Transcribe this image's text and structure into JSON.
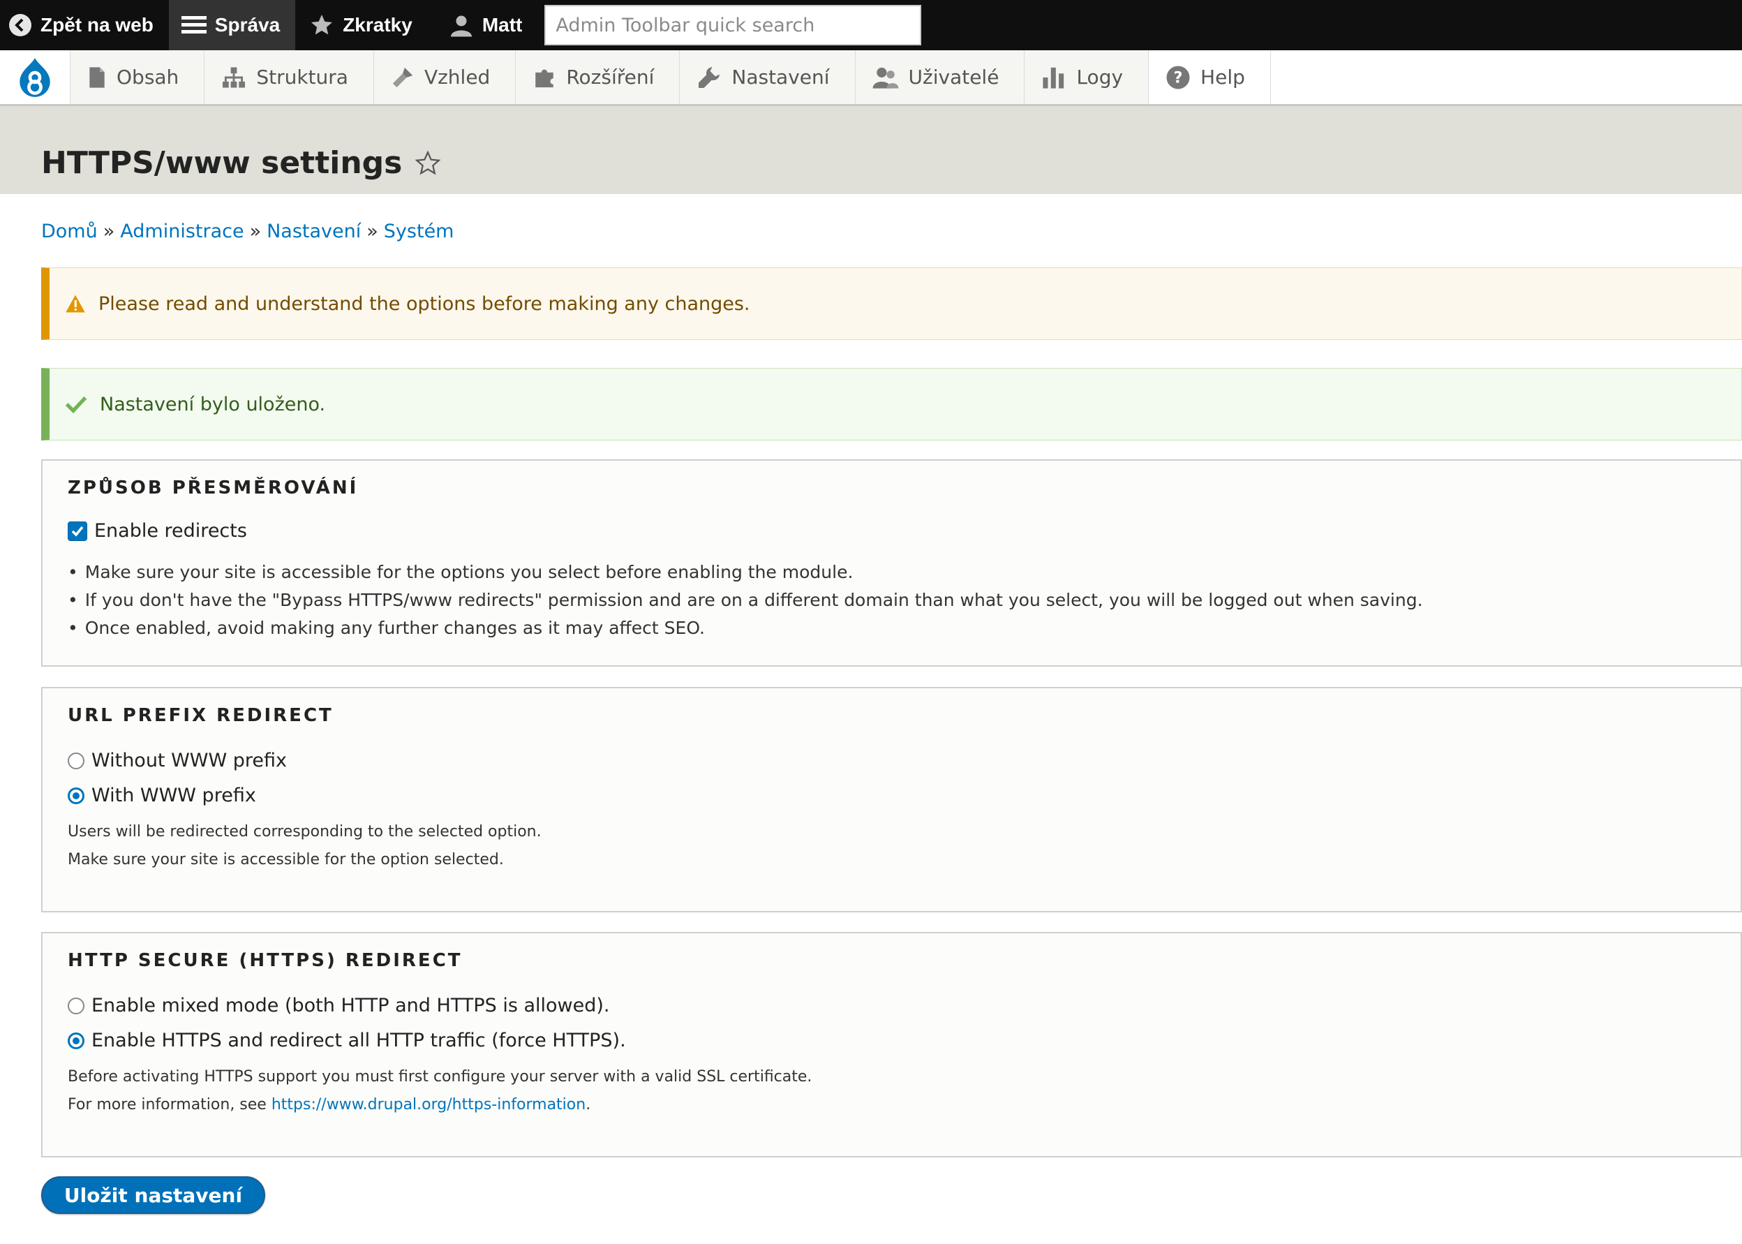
{
  "toolbar": {
    "back_label": "Zpět na web",
    "manage_label": "Správa",
    "shortcuts_label": "Zkratky",
    "user_label": "Matt",
    "search_placeholder": "Admin Toolbar quick search"
  },
  "tray": {
    "items": [
      {
        "label": "Obsah",
        "icon": "document-icon"
      },
      {
        "label": "Struktura",
        "icon": "sitemap-icon"
      },
      {
        "label": "Vzhled",
        "icon": "paintbrush-icon"
      },
      {
        "label": "Rozšíření",
        "icon": "puzzle-icon"
      },
      {
        "label": "Nastavení",
        "icon": "wrench-icon"
      },
      {
        "label": "Uživatelé",
        "icon": "people-icon"
      },
      {
        "label": "Logy",
        "icon": "bar-chart-icon"
      },
      {
        "label": "Help",
        "icon": "help-icon"
      }
    ]
  },
  "page": {
    "title": "HTTPS/www settings"
  },
  "breadcrumb": {
    "items": [
      "Domů",
      "Administrace",
      "Nastavení",
      "Systém"
    ],
    "separator": "»"
  },
  "messages": {
    "warning": "Please read and understand the options before making any changes.",
    "status": "Nastavení bylo uloženo."
  },
  "redirect_method": {
    "legend": "ZPŮSOB PŘESMĚROVÁNÍ",
    "checkbox_label": "Enable redirects",
    "checked": true,
    "bullets": [
      "Make sure your site is accessible for the options you select before enabling the module.",
      "If you don't have the \"Bypass HTTPS/www redirects\" permission and are on a different domain than what you select, you will be logged out when saving.",
      "Once enabled, avoid making any further changes as it may affect SEO."
    ]
  },
  "url_prefix": {
    "legend": "URL PREFIX REDIRECT",
    "options": [
      "Without WWW prefix",
      "With WWW prefix"
    ],
    "selected": "With WWW prefix",
    "desc_1": "Users will be redirected corresponding to the selected option.",
    "desc_2": "Make sure your site is accessible for the option selected."
  },
  "https": {
    "legend": "HTTP SECURE (HTTPS) REDIRECT",
    "options": [
      "Enable mixed mode (both HTTP and HTTPS is allowed).",
      "Enable HTTPS and redirect all HTTP traffic (force HTTPS)."
    ],
    "selected": "Enable HTTPS and redirect all HTTP traffic (force HTTPS).",
    "desc_1": "Before activating HTTPS support you must first configure your server with a valid SSL certificate.",
    "desc_2_prefix": "For more information, see",
    "desc_2_link": "https://www.drupal.org/https-information",
    "desc_2_suffix": "."
  },
  "save_label": "Uložit nastavení",
  "colors": {
    "link": "#0074bd",
    "warning_border": "#e09600",
    "status_border": "#77b259",
    "button": "#0071b8"
  }
}
